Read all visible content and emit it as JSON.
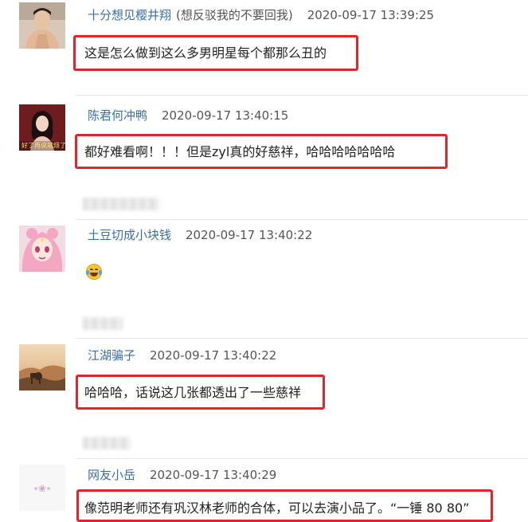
{
  "comments": [
    {
      "username": "十分想见樱井翔",
      "note": "(想反驳我的不要回我)",
      "timestamp": "2020-09-17 13:39:25",
      "text": "这是怎么做到这么多男明星每个都那么丑的",
      "avatar_icon": "user-avatar-man-photo-icon"
    },
    {
      "username": "陈君何冲鸭",
      "timestamp": "2020-09-17 13:40:15",
      "text": "都好难看啊！！！但是zyl真的好慈祥，哈哈哈哈哈哈哈",
      "avatar_icon": "user-avatar-woman-photo-icon",
      "avatar_caption": "好了再说就烦了"
    },
    {
      "username": "土豆切成小块钱",
      "timestamp": "2020-09-17 13:40:22",
      "emoji": "laugh-cry-emoji-icon",
      "avatar_icon": "user-avatar-anime-girl-icon"
    },
    {
      "username": "江湖骗子",
      "timestamp": "2020-09-17 13:40:22",
      "text": "哈哈哈，话说这几张都透出了一些慈祥",
      "avatar_icon": "user-avatar-landscape-icon"
    },
    {
      "username": "网友小岳",
      "timestamp": "2020-09-17 13:40:29",
      "text": "像范明老师还有巩汉林老师的合体，可以去演小品了。“一锤 80 80”",
      "avatar_icon": "user-avatar-default-icon"
    }
  ],
  "colors": {
    "username": "#3a6ea5",
    "highlight_border": "#e0262b",
    "divider": "#e6e6e6"
  }
}
